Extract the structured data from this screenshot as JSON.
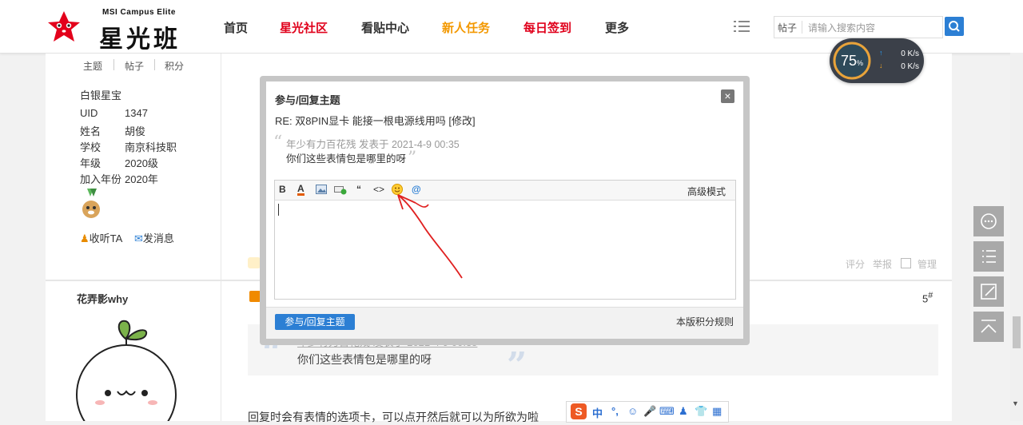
{
  "header": {
    "logo_sub": "MSI Campus Elite",
    "logo_main": "星光班",
    "nav": [
      {
        "label": "首页",
        "color": "#333333"
      },
      {
        "label": "星光社区",
        "color": "#e0001b"
      },
      {
        "label": "看贴中心",
        "color": "#333333"
      },
      {
        "label": "新人任务",
        "color": "#f39800"
      },
      {
        "label": "每日签到",
        "color": "#e0001b"
      },
      {
        "label": "更多",
        "color": "#333333"
      }
    ],
    "search": {
      "type": "帖子",
      "placeholder": "请输入搜索内容"
    }
  },
  "speed_widget": {
    "percent": "75",
    "percent_unit": "%",
    "upload": "0 K/s",
    "download": "0 K/s"
  },
  "user_sidebar": {
    "stat_tabs": [
      "主题",
      "帖子",
      "积分"
    ],
    "title": "白银星宝",
    "info": [
      {
        "key": "UID",
        "value": "1347"
      },
      {
        "key": "姓名",
        "value": "胡俊"
      },
      {
        "key": "学校",
        "value": "南京科技职"
      },
      {
        "key": "年级",
        "value": "2020级"
      },
      {
        "key": "加入年份",
        "value": "2020年"
      }
    ],
    "actions": {
      "follow": "收听TA",
      "message": "发消息"
    }
  },
  "post_actions": {
    "rate": "评分",
    "report": "举报",
    "manage": "管理"
  },
  "post2": {
    "author": "花弄影why",
    "floor": "5",
    "quote_meta": "年少有力百花残 发表于 2021-4-9 00:35",
    "quote_text": "你们这些表情包是哪里的呀",
    "body": "回复时会有表情的选项卡，可以点开然后就可以为所欲为啦"
  },
  "ime_bar": {
    "items": [
      "中",
      "°,",
      "☺",
      "🎤",
      "⌨",
      "♟",
      "👕",
      "▦"
    ]
  },
  "modal": {
    "title": "参与/回复主题",
    "close": "×",
    "subject": "RE: 双8PIN显卡 能接一根电源线用吗 [修改]",
    "quote_meta": "年少有力百花残 发表于 2021-4-9 00:35",
    "quote_text": "你们这些表情包是哪里的呀",
    "toolbar": {
      "bold": "B",
      "font_color": "A",
      "quote": "“",
      "code": "<>",
      "at": "@",
      "advanced": "高级模式"
    },
    "submit": "参与/回复主题",
    "rules": "本版积分规则"
  }
}
